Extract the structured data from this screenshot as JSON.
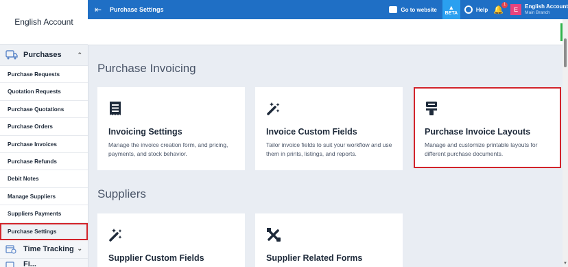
{
  "sidebar": {
    "account": "English Account",
    "group": "Purchases",
    "items": [
      "Purchase Requests",
      "Quotation Requests",
      "Purchase Quotations",
      "Purchase Orders",
      "Purchase Invoices",
      "Purchase Refunds",
      "Debit Notes",
      "Manage Suppliers",
      "Suppliers Payments",
      "Purchase Settings"
    ],
    "time_tracking": "Time Tracking",
    "next_group": "Fi..."
  },
  "topbar": {
    "title": "Purchase Settings",
    "go_to_website": "Go to website",
    "beta": "BETA",
    "help": "Help",
    "notif_count": "1",
    "avatar_letter": "E",
    "account_name": "English Account",
    "branch": "Main Branch"
  },
  "sections": {
    "invoicing": "Purchase Invoicing",
    "suppliers": "Suppliers"
  },
  "cards": {
    "invoicing_settings": {
      "title": "Invoicing Settings",
      "desc": "Manage the invoice creation form, and pricing, payments, and stock behavior."
    },
    "invoice_custom_fields": {
      "title": "Invoice Custom Fields",
      "desc": "Tailor invoice fields to suit your workflow and use them in prints, listings, and reports."
    },
    "purchase_invoice_layouts": {
      "title": "Purchase Invoice Layouts",
      "desc": "Manage and customize printable layouts for different purchase documents."
    },
    "supplier_custom_fields": {
      "title": "Supplier Custom Fields"
    },
    "supplier_related_forms": {
      "title": "Supplier Related Forms"
    }
  },
  "colors": {
    "topbar": "#1f6fc5",
    "highlight": "#d2232a",
    "page_bg": "#e9edf3"
  }
}
